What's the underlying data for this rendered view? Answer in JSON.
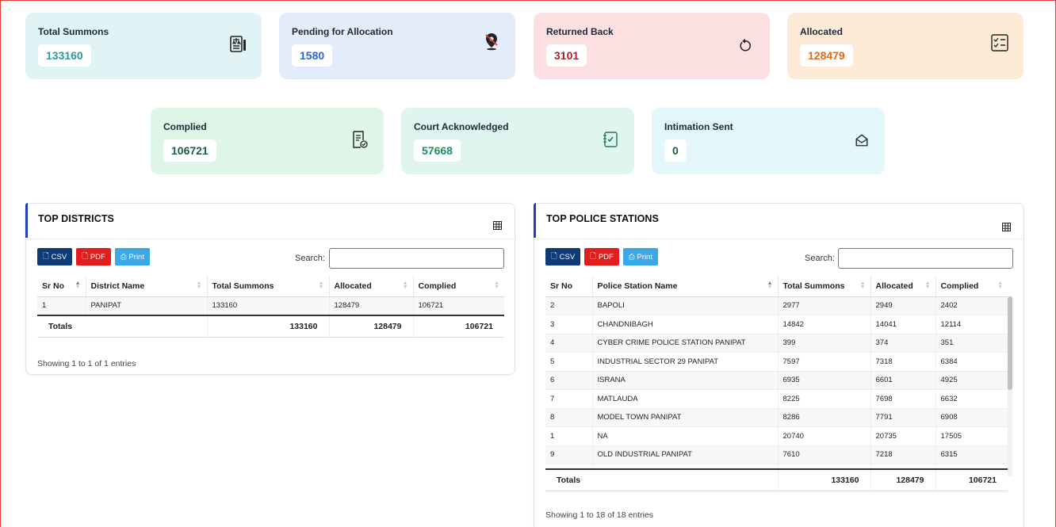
{
  "colors": {
    "card_teal": "#e0f4f6",
    "card_blue": "#e2ecfb",
    "card_pink": "#fbdfe1",
    "card_orange": "#fdebd7",
    "card_green": "#def6e8",
    "card_mint": "#e0f5ef",
    "card_cyan": "#e4f8fb",
    "value_teal": "#2a9a9b",
    "value_blue": "#2d63d2",
    "value_red": "#a8232d",
    "value_orange": "#e06a1c",
    "value_darkgreen": "#1e5c46",
    "value_green": "#1f8f5a",
    "value_dark": "#1e5c46"
  },
  "cards": [
    {
      "title": "Total Summons",
      "value": "133160",
      "icon": "judge-document-icon"
    },
    {
      "title": "Pending for Allocation",
      "value": "1580",
      "icon": "pin-off-icon"
    },
    {
      "title": "Returned Back",
      "value": "3101",
      "icon": "rotate-back-icon"
    },
    {
      "title": "Allocated",
      "value": "128479",
      "icon": "checklist-icon"
    },
    {
      "title": "Complied",
      "value": "106721",
      "icon": "document-check-icon"
    },
    {
      "title": "Court Acknowledged",
      "value": "57668",
      "icon": "notebook-check-icon"
    },
    {
      "title": "Intimation Sent",
      "value": "0",
      "icon": "envelope-open-icon"
    }
  ],
  "districts": {
    "title": "TOP DISTRICTS",
    "buttons": {
      "csv": "CSV",
      "pdf": "PDF",
      "print": "Print"
    },
    "search_label": "Search:",
    "search_value": "",
    "headers": [
      "Sr No",
      "District Name",
      "Total Summons",
      "Allocated",
      "Complied"
    ],
    "rows": [
      [
        "1",
        "PANIPAT",
        "133160",
        "128479",
        "106721"
      ]
    ],
    "totals": {
      "label": "Totals",
      "total_summons": "133160",
      "allocated": "128479",
      "complied": "106721"
    },
    "info": "Showing 1 to 1 of 1 entries"
  },
  "stations": {
    "title": "TOP POLICE STATIONS",
    "buttons": {
      "csv": "CSV",
      "pdf": "PDF",
      "print": "Print"
    },
    "search_label": "Search:",
    "search_value": "",
    "headers": [
      "Sr No",
      "Police Station Name",
      "Total Summons",
      "Allocated",
      "Complied"
    ],
    "rows": [
      [
        "2",
        "BAPOLI",
        "2977",
        "2949",
        "2402"
      ],
      [
        "3",
        "CHANDNIBAGH",
        "14842",
        "14041",
        "12114"
      ],
      [
        "4",
        "CYBER CRIME POLICE STATION PANIPAT",
        "399",
        "374",
        "351"
      ],
      [
        "5",
        "INDUSTRIAL SECTOR 29 PANIPAT",
        "7597",
        "7318",
        "6384"
      ],
      [
        "6",
        "ISRANA",
        "6935",
        "6601",
        "4925"
      ],
      [
        "7",
        "MATLAUDA",
        "8225",
        "7698",
        "6632"
      ],
      [
        "8",
        "MODEL TOWN PANIPAT",
        "8286",
        "7791",
        "6908"
      ],
      [
        "1",
        "NA",
        "20740",
        "20735",
        "17505"
      ],
      [
        "9",
        "OLD INDUSTRIAL PANIPAT",
        "7610",
        "7218",
        "6315"
      ]
    ],
    "totals": {
      "label": "Totals",
      "total_summons": "133160",
      "allocated": "128479",
      "complied": "106721"
    },
    "info": "Showing 1 to 18 of 18 entries"
  }
}
